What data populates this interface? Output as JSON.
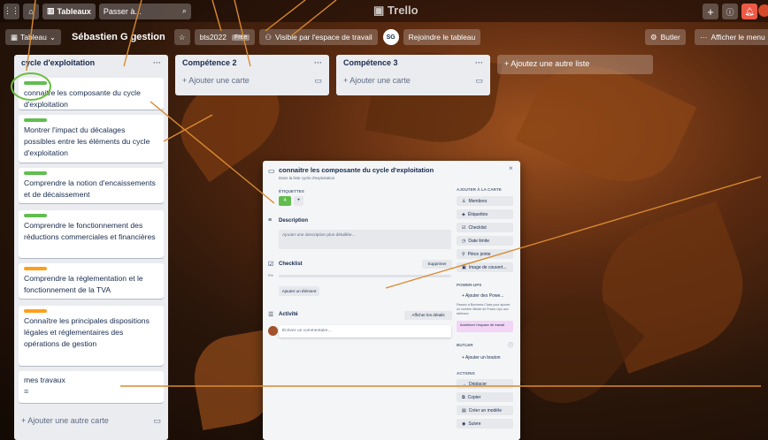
{
  "topbar": {
    "boards_label": "Tableaux",
    "search_placeholder": "Passer à...",
    "logo_text": "Trello"
  },
  "boardbar": {
    "view_label": "Tableau",
    "board_title": "Sébastien G gestion",
    "workspace_label": "bts2022",
    "workspace_badge": "Free",
    "visibility_label": "Visible par l'espace de travail",
    "avatar_initials": "SG",
    "join_label": "Rejoindre le tableau",
    "butler_label": "Butler",
    "menu_label": "Afficher le menu"
  },
  "lists": [
    {
      "title": "cycle d'exploitation",
      "cards": [
        {
          "label_color": "#61bd4f",
          "text": "connaitre les composante du cycle d'exploitation"
        },
        {
          "label_color": "#61bd4f",
          "text": "Montrer l'impact du décalages possibles entre les éléments du cycle d'exploitation"
        },
        {
          "label_color": "#61bd4f",
          "text": "Comprendre la notion d'encaissements et de décaissement"
        },
        {
          "label_color": "#61bd4f",
          "text": "Comprendre le fonctionnement des réductions commerciales et financières"
        },
        {
          "label_color": "#ff9f1a",
          "text": "Comprendre la réglementation et le fonctionnement de la TVA"
        },
        {
          "label_color": "#ff9f1a",
          "text": "Connaître les principales dispositions légales et réglementaires des opérations de gestion"
        },
        {
          "label_color": "",
          "text": "mes travaux"
        }
      ],
      "add_card": "+ Ajouter une autre carte"
    },
    {
      "title": "Compétence 2",
      "add_card": "+ Ajouter une carte"
    },
    {
      "title": "Compétence 3",
      "add_card": "+ Ajouter une carte"
    }
  ],
  "add_list": "+ Ajoutez une autre liste",
  "modal": {
    "title": "connaitre les composante du cycle d'exploitation",
    "in_list": "Dans la liste cycle d'exploitation",
    "labels_heading": "ÉTIQUETTES",
    "label_value": "4",
    "description_heading": "Description",
    "description_placeholder": "Ajouter une description plus détaillée...",
    "checklist_heading": "Checklist",
    "delete_label": "Supprimer",
    "progress": "0%",
    "add_item": "Ajouter un élément",
    "activity_heading": "Activité",
    "show_details": "Afficher les détails",
    "comment_placeholder": "Écrivez un commentaire...",
    "add_to_card_heading": "AJOUTER À LA CARTE",
    "side_buttons": [
      "Membres",
      "Étiquettes",
      "Checklist",
      "Date limite",
      "Pièce jointe",
      "Image de couvert..."
    ],
    "powerups_heading": "POWER-UPS",
    "add_powerups": "+ Ajouter des Powe...",
    "powerups_text": "Passez à Business Class pour ajouter un nombre illimité de Power-Ups aux tableaux.",
    "upgrade_label": "Améliorer l'espace de travail",
    "butler_heading": "BUTLER",
    "add_button": "+ Ajouter un bouton",
    "actions_heading": "ACTIONS",
    "action_buttons": [
      "Déplacer",
      "Copier",
      "Créer un modèle",
      "Suivre"
    ]
  }
}
